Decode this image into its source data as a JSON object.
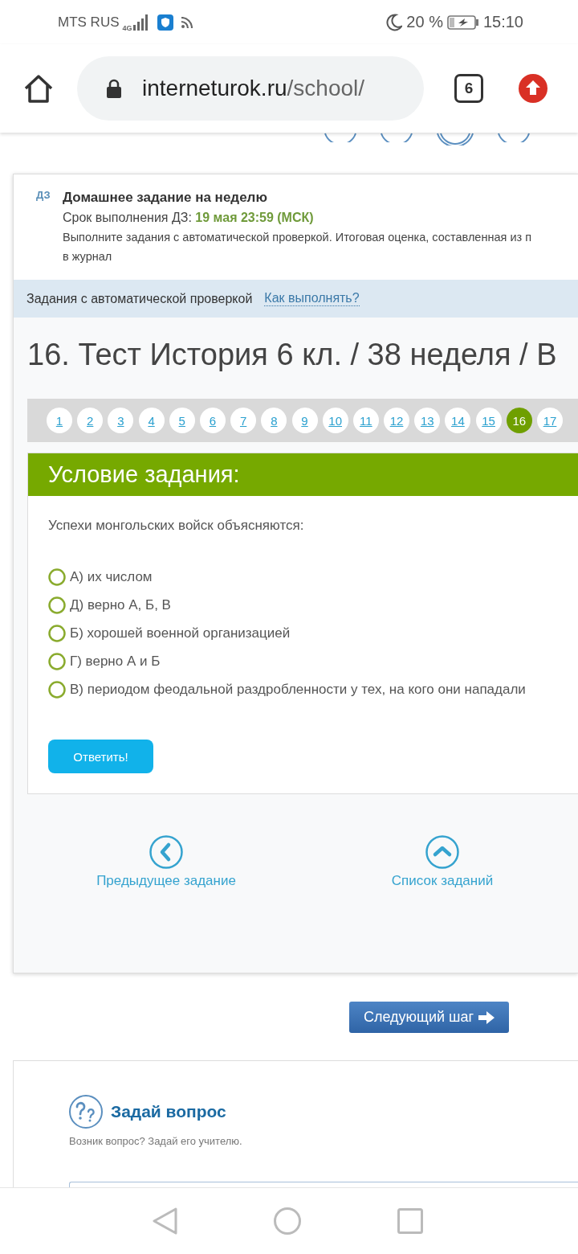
{
  "status_bar": {
    "carrier": "MTS RUS",
    "network": "4G",
    "battery": "20 %",
    "time": "15:10"
  },
  "browser": {
    "url_host": "interneturok.ru",
    "url_path": "/school/",
    "tab_count": "6"
  },
  "homework": {
    "badge": "ДЗ",
    "title": "Домашнее задание на неделю",
    "deadline": "Срок выполнения ДЗ: **19 мая 23:59 (МСК)**",
    "description_lines": [
      "Выполните задания с автоматической проверкой. Итоговая оценка, составленная из п",
      "в журнал"
    ]
  },
  "info_bar": {
    "text": "Задания с автоматической проверкой",
    "link": "Как выполнять?"
  },
  "test_title": "16. Тест История 6 кл. / 38 неделя / В",
  "pagination": [
    {
      "label": "1",
      "selected": false
    },
    {
      "label": "2",
      "selected": false
    },
    {
      "label": "3",
      "selected": false
    },
    {
      "label": "4",
      "selected": false
    },
    {
      "label": "5",
      "selected": false
    },
    {
      "label": "6",
      "selected": false
    },
    {
      "label": "7",
      "selected": false
    },
    {
      "label": "8",
      "selected": false
    },
    {
      "label": "9",
      "selected": false
    },
    {
      "label": "10",
      "selected": false
    },
    {
      "label": "11",
      "selected": false
    },
    {
      "label": "12",
      "selected": false
    },
    {
      "label": "13",
      "selected": false
    },
    {
      "label": "14",
      "selected": false
    },
    {
      "label": "15",
      "selected": false
    },
    {
      "label": "16",
      "selected": true
    },
    {
      "label": "17",
      "selected": false
    }
  ],
  "task": {
    "header": "Условие задания:",
    "question": "Успехи монгольских войск объясняются:",
    "options": [
      {
        "label": "А) их числом",
        "selected": false
      },
      {
        "label": "Д) верно А, Б, В",
        "selected": false
      },
      {
        "label": "Б) хорошей военной организацией",
        "selected": false
      },
      {
        "label": "Г) верно А и Б",
        "selected": false
      },
      {
        "label": "В) периодом феодальной раздробленности у тех, на кого они нападали",
        "selected": false
      }
    ],
    "submit": "Ответить!"
  },
  "task_nav": [
    {
      "kind": "previous",
      "label": "Предыдущее задание"
    },
    {
      "kind": "list",
      "label": "Список заданий"
    }
  ],
  "next_button": "Следующий шаг",
  "ask": {
    "title": "Задай вопрос",
    "subtitle": "Возник вопрос? Задай его учителю."
  }
}
